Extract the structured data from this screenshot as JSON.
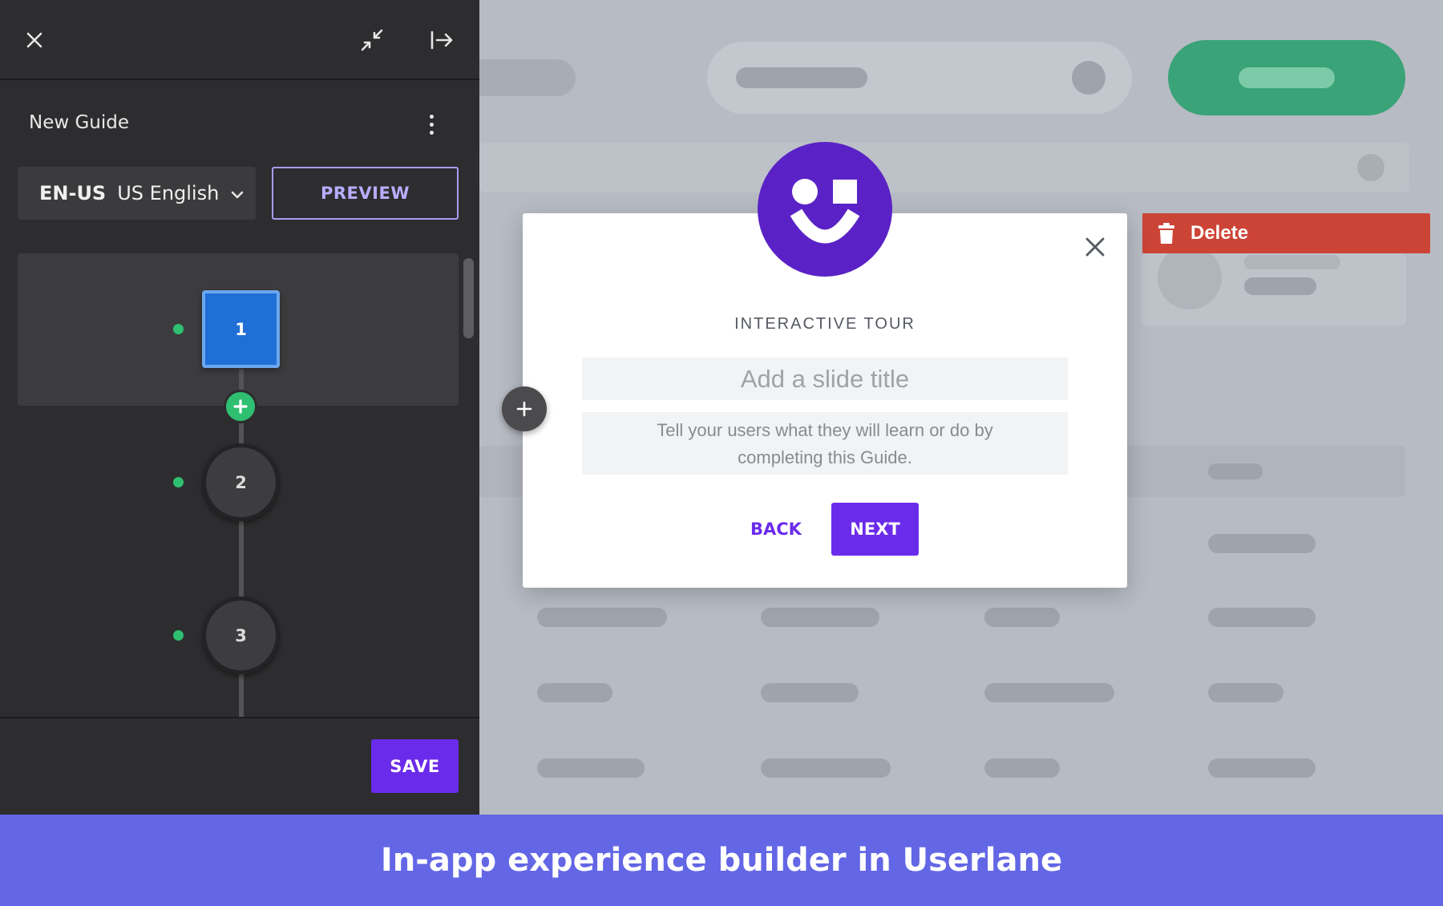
{
  "panel": {
    "close_icon": "close-icon",
    "collapse_icon": "collapse-icon",
    "dock_icon": "dock-right-icon",
    "guide_title": "New Guide",
    "menu_icon": "more-vertical-icon",
    "language": {
      "code": "EN-US",
      "name": "US English",
      "chevron_icon": "chevron-down-icon"
    },
    "preview_label": "PREVIEW",
    "steps": [
      {
        "number": "1",
        "active": true,
        "status_color": "#2fbf71"
      },
      {
        "number": "2",
        "active": false,
        "status_color": "#2fbf71"
      },
      {
        "number": "3",
        "active": false,
        "status_color": "#2fbf71"
      }
    ],
    "add_step_icon": "plus-icon",
    "save_label": "SAVE"
  },
  "modal": {
    "logo_icon": "smiley-logo-icon",
    "close_icon": "close-icon",
    "subtitle": "INTERACTIVE TOUR",
    "title_placeholder": "Add a slide title",
    "description_placeholder": "Tell your users what they will learn or do by completing this Guide.",
    "back_label": "BACK",
    "next_label": "NEXT",
    "add_slide_icon": "plus-icon"
  },
  "background_app": {
    "delete_label": "Delete",
    "delete_icon": "trash-icon"
  },
  "caption": "In-app experience builder in Userlane",
  "colors": {
    "panel_bg": "#2d2d2f",
    "accent_purple": "#6b2bea",
    "step_active": "#1f6fd6",
    "success_green": "#2fbf71",
    "delete_red": "#cc4436",
    "caption_bg": "#6366e5"
  }
}
